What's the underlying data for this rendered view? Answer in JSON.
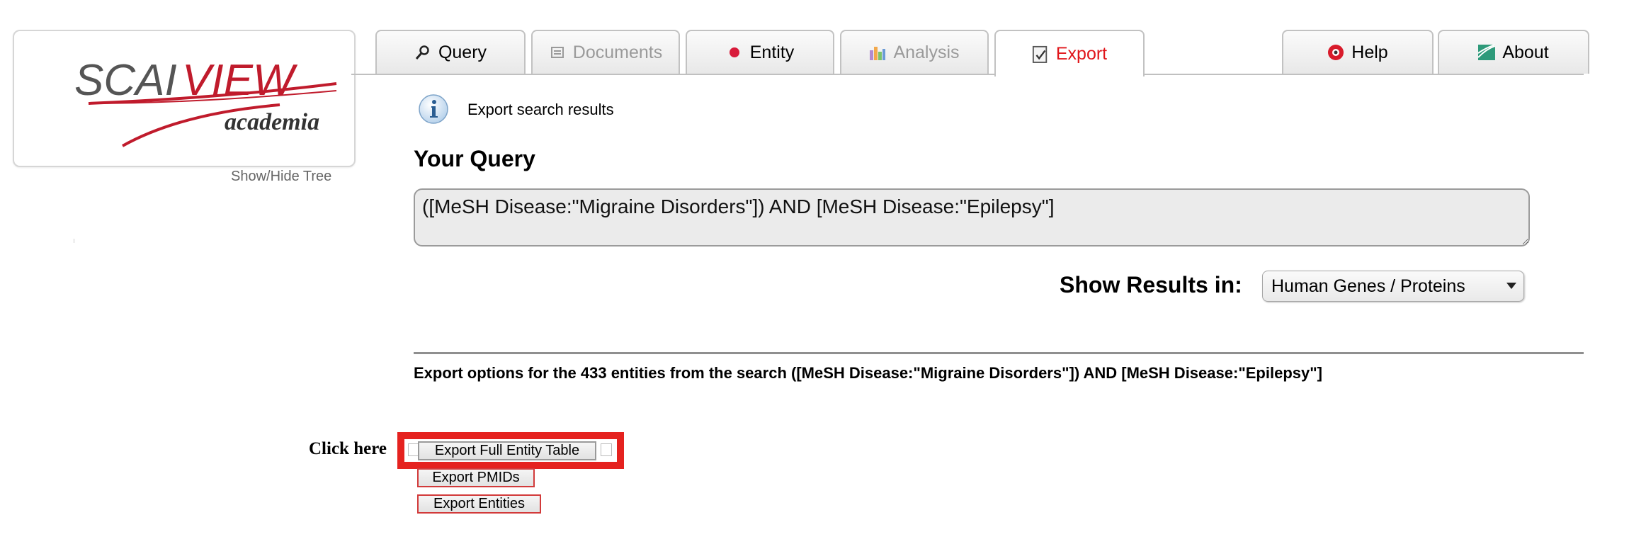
{
  "logo": {
    "text_main": "SCAI",
    "text_view": "VIEW",
    "text_sub": "academia",
    "colors": {
      "grey": "#555555",
      "red": "#c01b2c"
    }
  },
  "sidebar": {
    "show_hide_tree": "Show/Hide Tree"
  },
  "tabs": [
    {
      "label": "Query",
      "icon": "magnifier-icon",
      "state": "enabled"
    },
    {
      "label": "Documents",
      "icon": "document-icon",
      "state": "disabled"
    },
    {
      "label": "Entity",
      "icon": "red-dot-icon",
      "state": "enabled"
    },
    {
      "label": "Analysis",
      "icon": "bar-chart-icon",
      "state": "disabled"
    },
    {
      "label": "Export",
      "icon": "export-check-icon",
      "state": "active"
    },
    {
      "label": "Help",
      "icon": "help-icon",
      "state": "enabled"
    },
    {
      "label": "About",
      "icon": "about-icon",
      "state": "enabled"
    }
  ],
  "info": {
    "text": "Export search results",
    "icon": "info-icon"
  },
  "query": {
    "heading": "Your Query",
    "value": "([MeSH Disease:\"Migraine Disorders\"]) AND [MeSH Disease:\"Epilepsy\"]"
  },
  "results": {
    "label": "Show Results in:",
    "selected": "Human Genes / Proteins"
  },
  "export": {
    "options_text": "Export options for the 433 entities from the search ([MeSH Disease:\"Migraine Disorders\"]) AND [MeSH Disease:\"Epilepsy\"]",
    "click_here": "Click here",
    "buttons": {
      "full_table": "Export Full Entity Table",
      "pmids": "Export PMIDs",
      "entities": "Export Entities"
    },
    "highlight_color": "#e5221f"
  },
  "colors": {
    "active_tab_text": "#e0151a",
    "disabled_tab_text": "#9a9a9a"
  }
}
